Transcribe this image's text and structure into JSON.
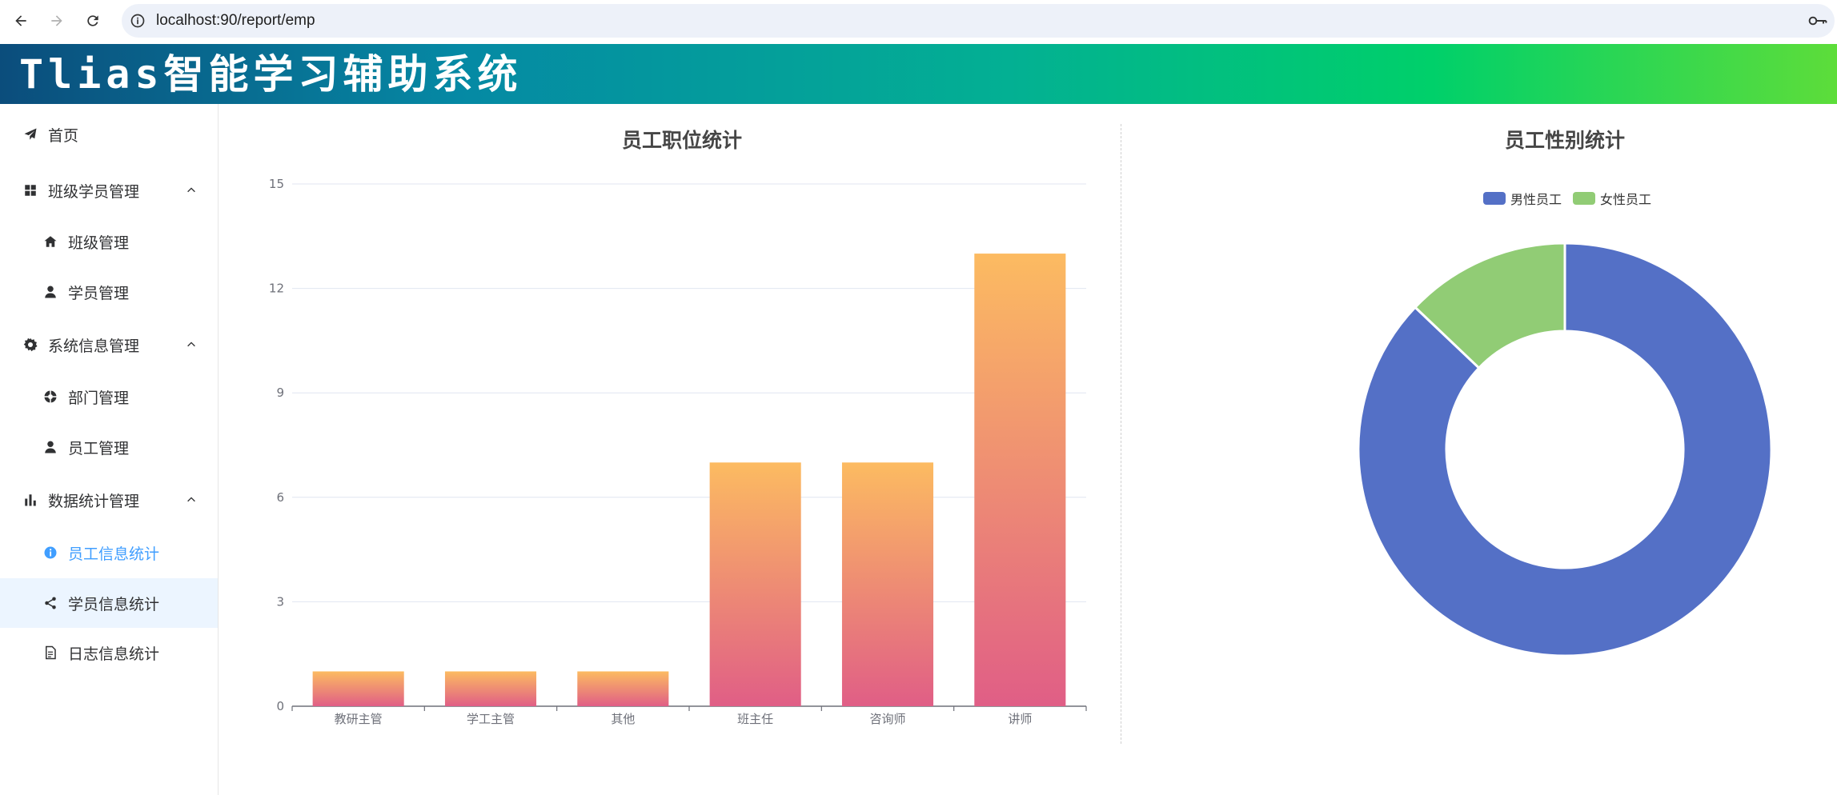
{
  "browser": {
    "url": "localhost:90/report/emp",
    "icons": [
      "back-arrow-icon",
      "forward-arrow-icon",
      "reload-icon",
      "site-info-icon",
      "password-key-icon"
    ]
  },
  "app": {
    "title": "Tlias智能学习辅助系统",
    "accent_color": "#409eff"
  },
  "sidebar": {
    "items": [
      {
        "label": "首页",
        "icon": "paper-plane-icon",
        "level": 1
      },
      {
        "label": "班级学员管理",
        "icon": "grid-icon",
        "level": 1,
        "expanded": true
      },
      {
        "label": "班级管理",
        "icon": "home-icon",
        "level": 2
      },
      {
        "label": "学员管理",
        "icon": "user-icon",
        "level": 2
      },
      {
        "label": "系统信息管理",
        "icon": "gear-icon",
        "level": 1,
        "expanded": true
      },
      {
        "label": "部门管理",
        "icon": "aperture-icon",
        "level": 2
      },
      {
        "label": "员工管理",
        "icon": "user-icon",
        "level": 2
      },
      {
        "label": "数据统计管理",
        "icon": "bar-chart-icon",
        "level": 1,
        "expanded": true
      },
      {
        "label": "员工信息统计",
        "icon": "info-icon",
        "level": 2,
        "active": true
      },
      {
        "label": "学员信息统计",
        "icon": "share-icon",
        "level": 2,
        "hovered": true
      },
      {
        "label": "日志信息统计",
        "icon": "document-icon",
        "level": 2
      }
    ]
  },
  "chart_data": [
    {
      "type": "bar",
      "title": "员工职位统计",
      "categories": [
        "教研主管",
        "学工主管",
        "其他",
        "班主任",
        "咨询师",
        "讲师"
      ],
      "values": [
        1,
        1,
        1,
        7,
        7,
        13
      ],
      "ylim": [
        0,
        15
      ],
      "yticks": [
        0,
        3,
        6,
        9,
        12,
        15
      ],
      "grid": true,
      "colors": {
        "top": "#fcbb61",
        "bottom": "#e05e86"
      }
    },
    {
      "type": "pie",
      "title": "员工性别统计",
      "donut": true,
      "legend_position": "top-center",
      "series": [
        {
          "name": "男性员工",
          "value": 27,
          "color": "#5470c6"
        },
        {
          "name": "女性员工",
          "value": 4,
          "color": "#91cc75"
        }
      ]
    }
  ]
}
